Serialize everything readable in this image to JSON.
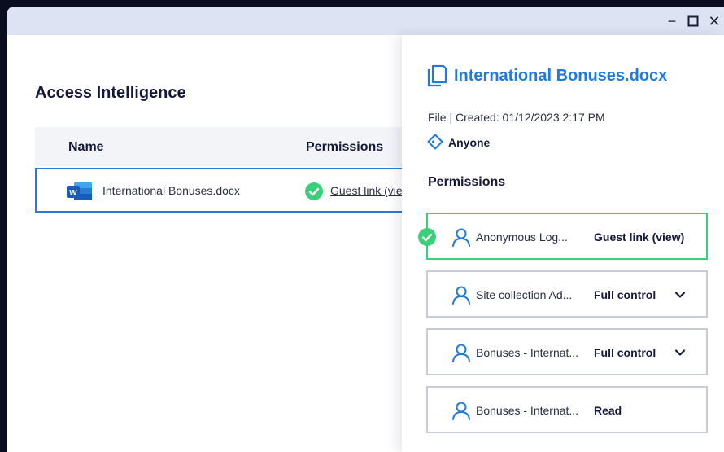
{
  "window_controls": {
    "minimize": "−",
    "maximize": "□",
    "close": "✕"
  },
  "main": {
    "title": "Access Intelligence",
    "table": {
      "columns": [
        "Name",
        "Permissions"
      ],
      "rows": [
        {
          "name": "International Bonuses.docx",
          "permission": "Guest link (view)",
          "icon": "word-doc-icon"
        }
      ]
    }
  },
  "panel": {
    "title": "International Bonuses.docx",
    "meta": "File | Created: 01/12/2023 2:17 PM",
    "sharing": "Anyone",
    "permissions_heading": "Permissions",
    "permissions": [
      {
        "name": "Anonymous Log...",
        "level": "Guest link (view)",
        "selected": true,
        "expandable": false
      },
      {
        "name": "Site collection Ad...",
        "level": "Full control",
        "selected": false,
        "expandable": true
      },
      {
        "name": "Bonuses - Internat...",
        "level": "Full control",
        "selected": false,
        "expandable": true
      },
      {
        "name": "Bonuses - Internat...",
        "level": "Read",
        "selected": false,
        "expandable": false
      }
    ]
  },
  "colors": {
    "accent": "#1f7ae0",
    "selected_border": "#2a79db",
    "success": "#3ccf7b",
    "title_text": "#14183a",
    "titlebar": "#dde3f3"
  }
}
